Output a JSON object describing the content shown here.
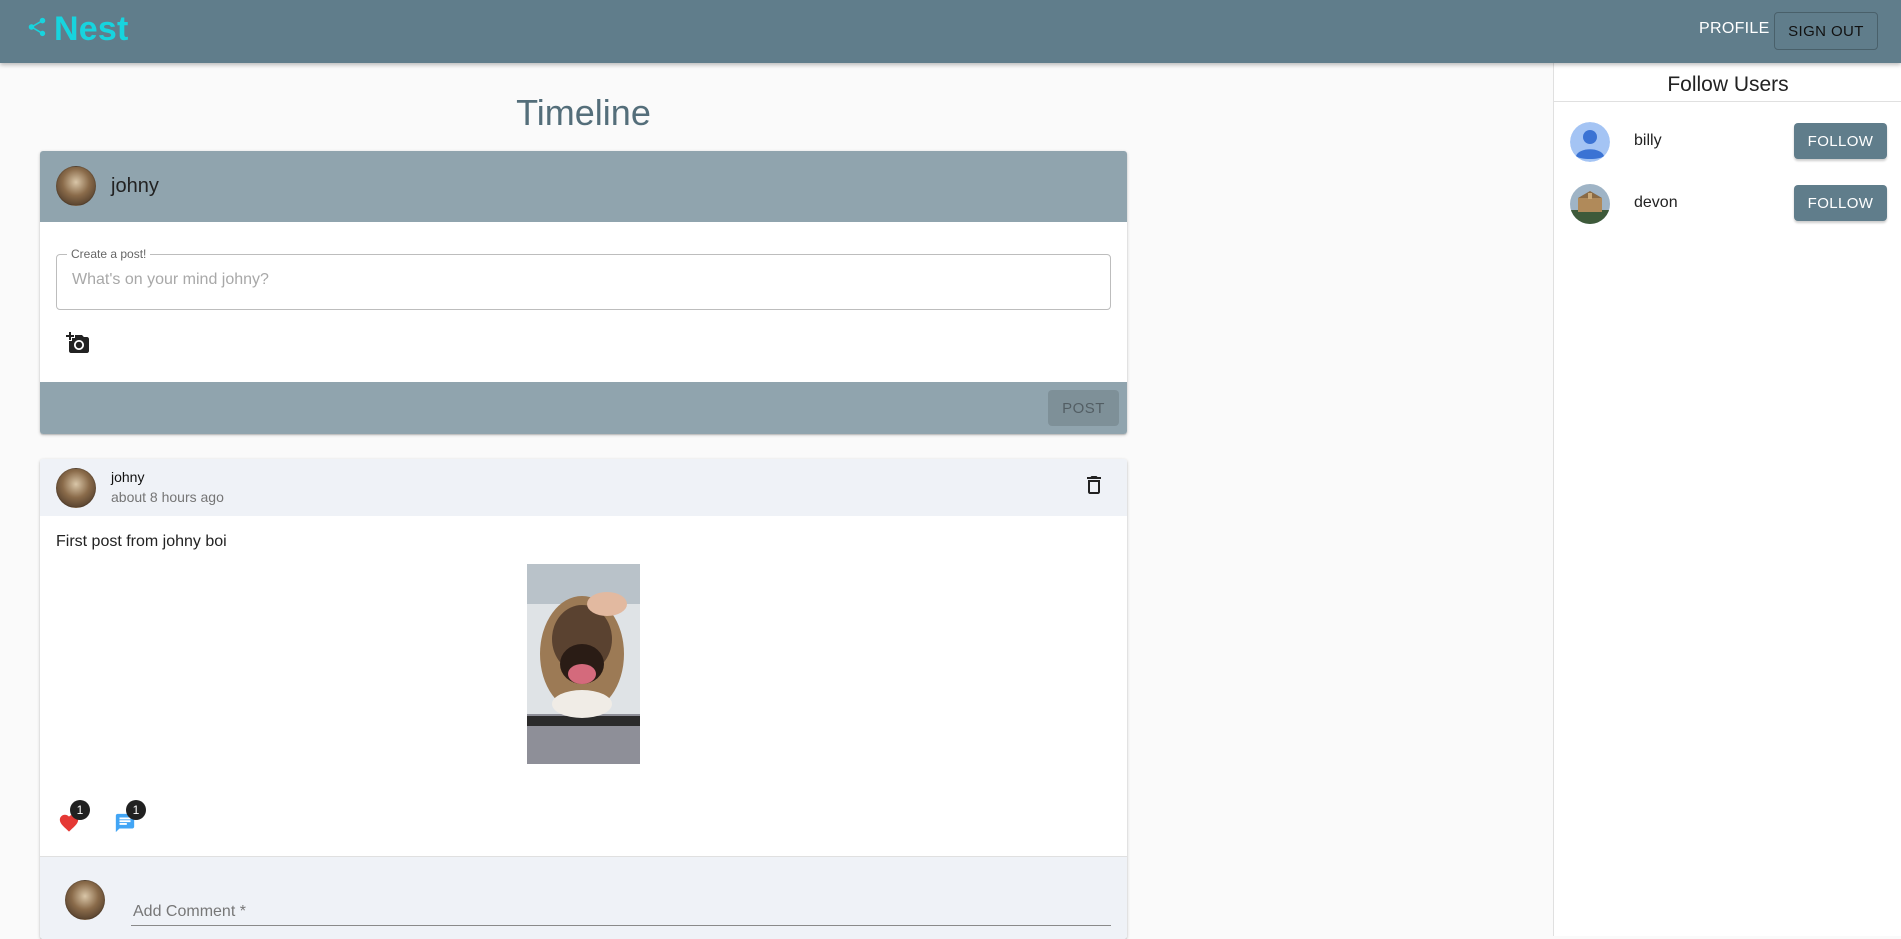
{
  "appbar": {
    "brand": "Nest",
    "brand_icon": "share-icon",
    "profile_label": "PROFILE",
    "signout_label": "SIGN OUT"
  },
  "main": {
    "title": "Timeline"
  },
  "create_post": {
    "username": "johny",
    "field_label": "Create a post!",
    "placeholder": "What's on your mind johny?",
    "photo_icon": "add-photo-icon",
    "post_label": "POST"
  },
  "post": {
    "author": "johny",
    "time": "about 8 hours ago",
    "text": "First post from johny boi",
    "likes": "1",
    "comments": "1",
    "comment_placeholder": "Add Comment *"
  },
  "sidebar": {
    "title": "Follow Users",
    "users": [
      {
        "name": "billy",
        "follow_label": "FOLLOW"
      },
      {
        "name": "devon",
        "follow_label": "FOLLOW"
      }
    ]
  },
  "colors": {
    "appbar": "#607d8b",
    "brand": "#17d4de",
    "card_header": "#90a4ae",
    "like": "#e53935",
    "comment": "#42a5f5"
  }
}
